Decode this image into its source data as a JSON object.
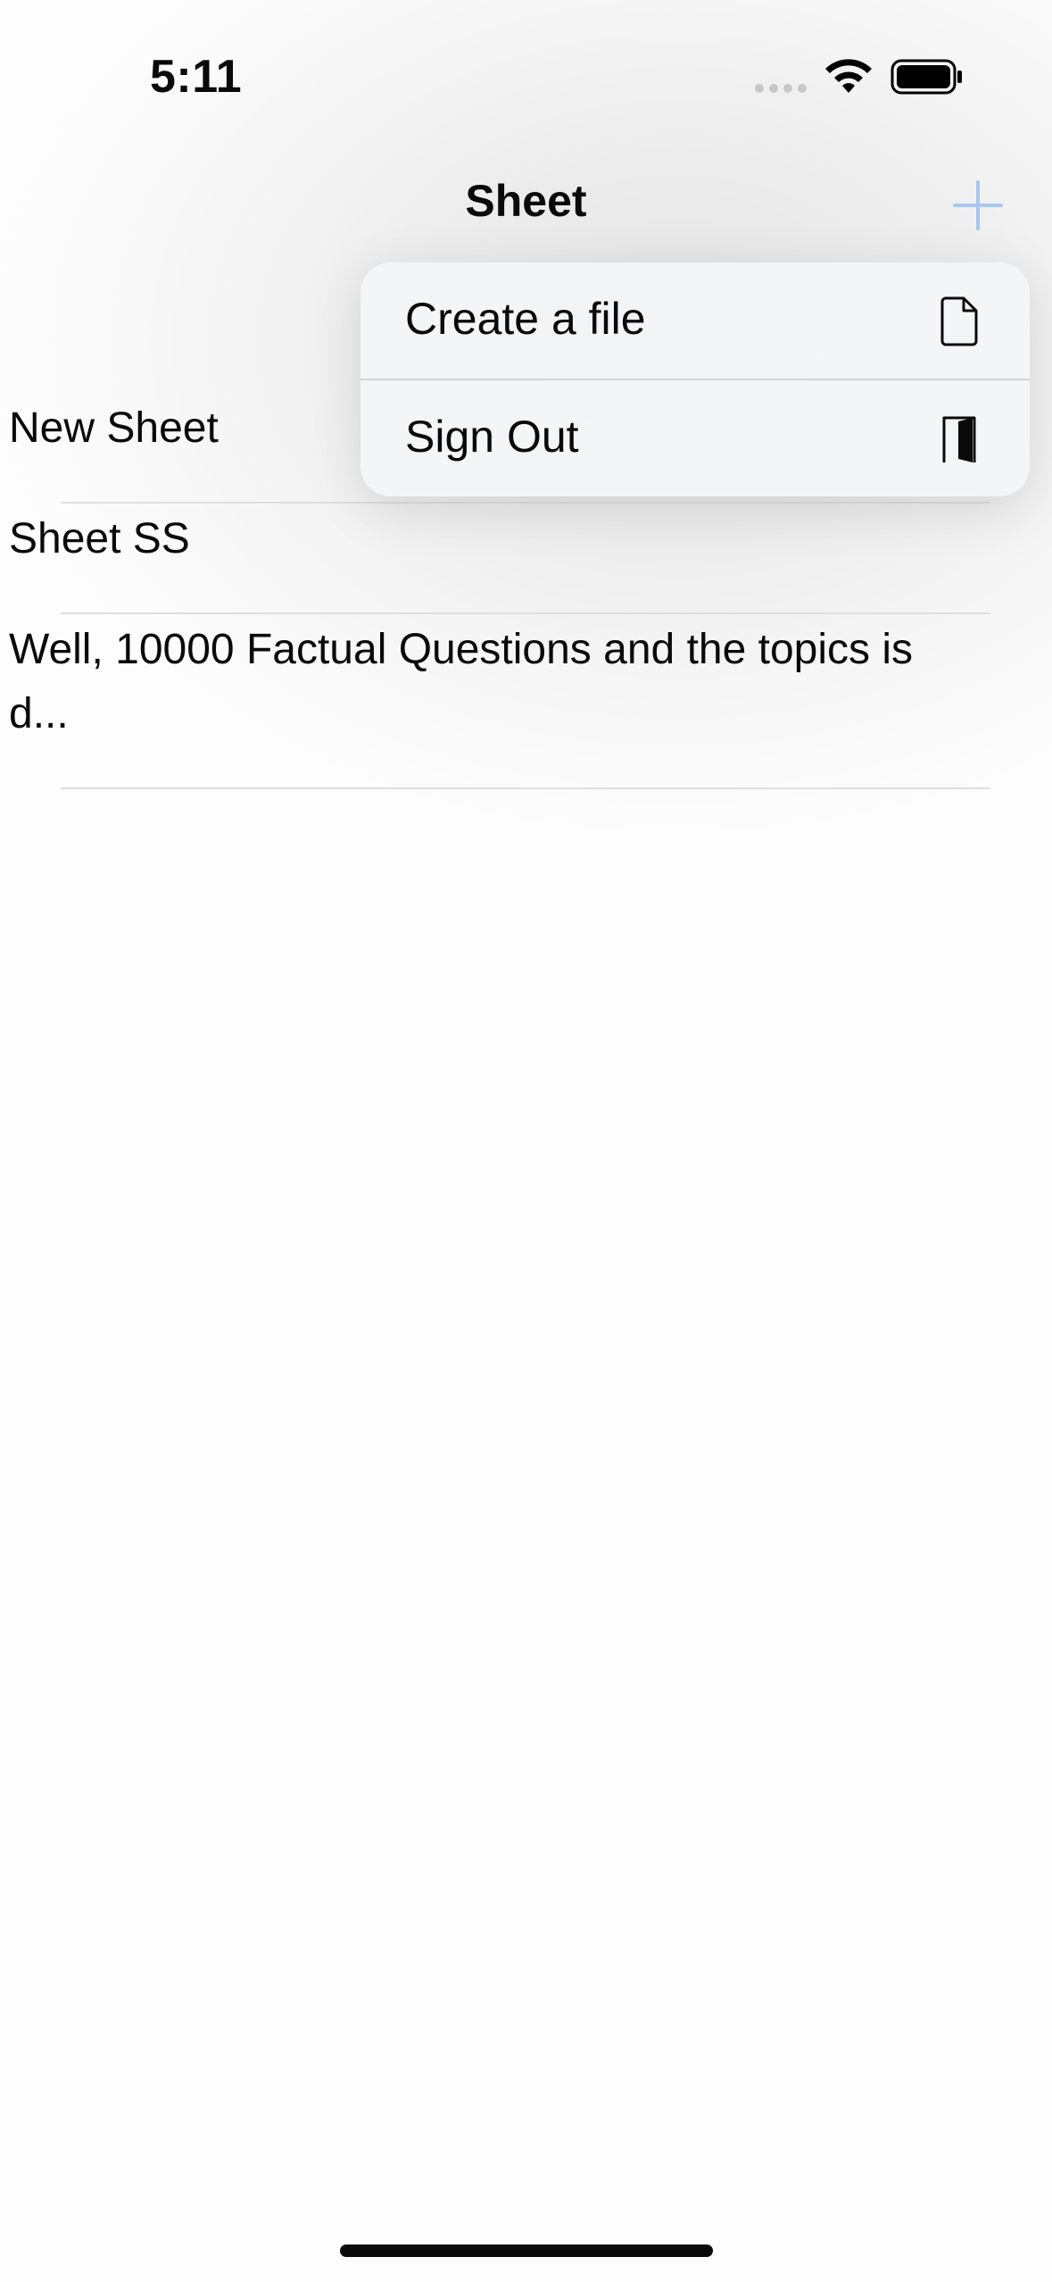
{
  "status_bar": {
    "time": "5:11",
    "icons": [
      "cellular-signal-icon",
      "wifi-icon",
      "battery-icon"
    ]
  },
  "nav": {
    "title": "Sheet",
    "add_icon": "plus-icon",
    "accent_color": "#a9c6f3"
  },
  "list": {
    "items": [
      {
        "text": "New Sheet"
      },
      {
        "text": "Sheet SS"
      },
      {
        "text": "Well, 10000 Factual Questions and the topics is d..."
      }
    ]
  },
  "menu": {
    "items": [
      {
        "label": "Create a file",
        "icon": "document-icon"
      },
      {
        "label": "Sign Out",
        "icon": "door-icon"
      }
    ]
  }
}
